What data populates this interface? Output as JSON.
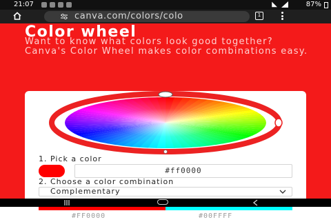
{
  "status_bar": {
    "time": "21:07",
    "battery_percent": "87%",
    "icons": [
      "notification-icon",
      "notification-icon",
      "notification-icon",
      "notification-icon",
      "wifi-icon",
      "signal-icon",
      "battery-icon"
    ]
  },
  "browser": {
    "url": "canva.com/colors/colo",
    "tab_count": "1",
    "icons": [
      "home-icon",
      "tune-icon",
      "tabs-icon",
      "overflow-menu-icon"
    ]
  },
  "hero": {
    "title": "Color wheel",
    "description": "Want to know what colors look good together? Canva's Color Wheel makes color combinations easy."
  },
  "tool": {
    "pick_label": "1. Pick a color",
    "selected_color": "#ff0000",
    "hex_value": "#ff0000",
    "combination_label": "2. Choose a color combination",
    "combination_value": "Complementary",
    "palette": [
      {
        "hex": "#ff0000",
        "label": "#FF0000"
      },
      {
        "hex": "#00ffff",
        "label": "#00FFFF"
      }
    ]
  },
  "colors": {
    "hero_bg": "#f41a1a",
    "status_bg": "#111111",
    "browser_bg": "#1f1f1f"
  },
  "nav": {
    "icons": [
      "recent-apps-icon",
      "home-button-icon",
      "back-icon"
    ]
  }
}
